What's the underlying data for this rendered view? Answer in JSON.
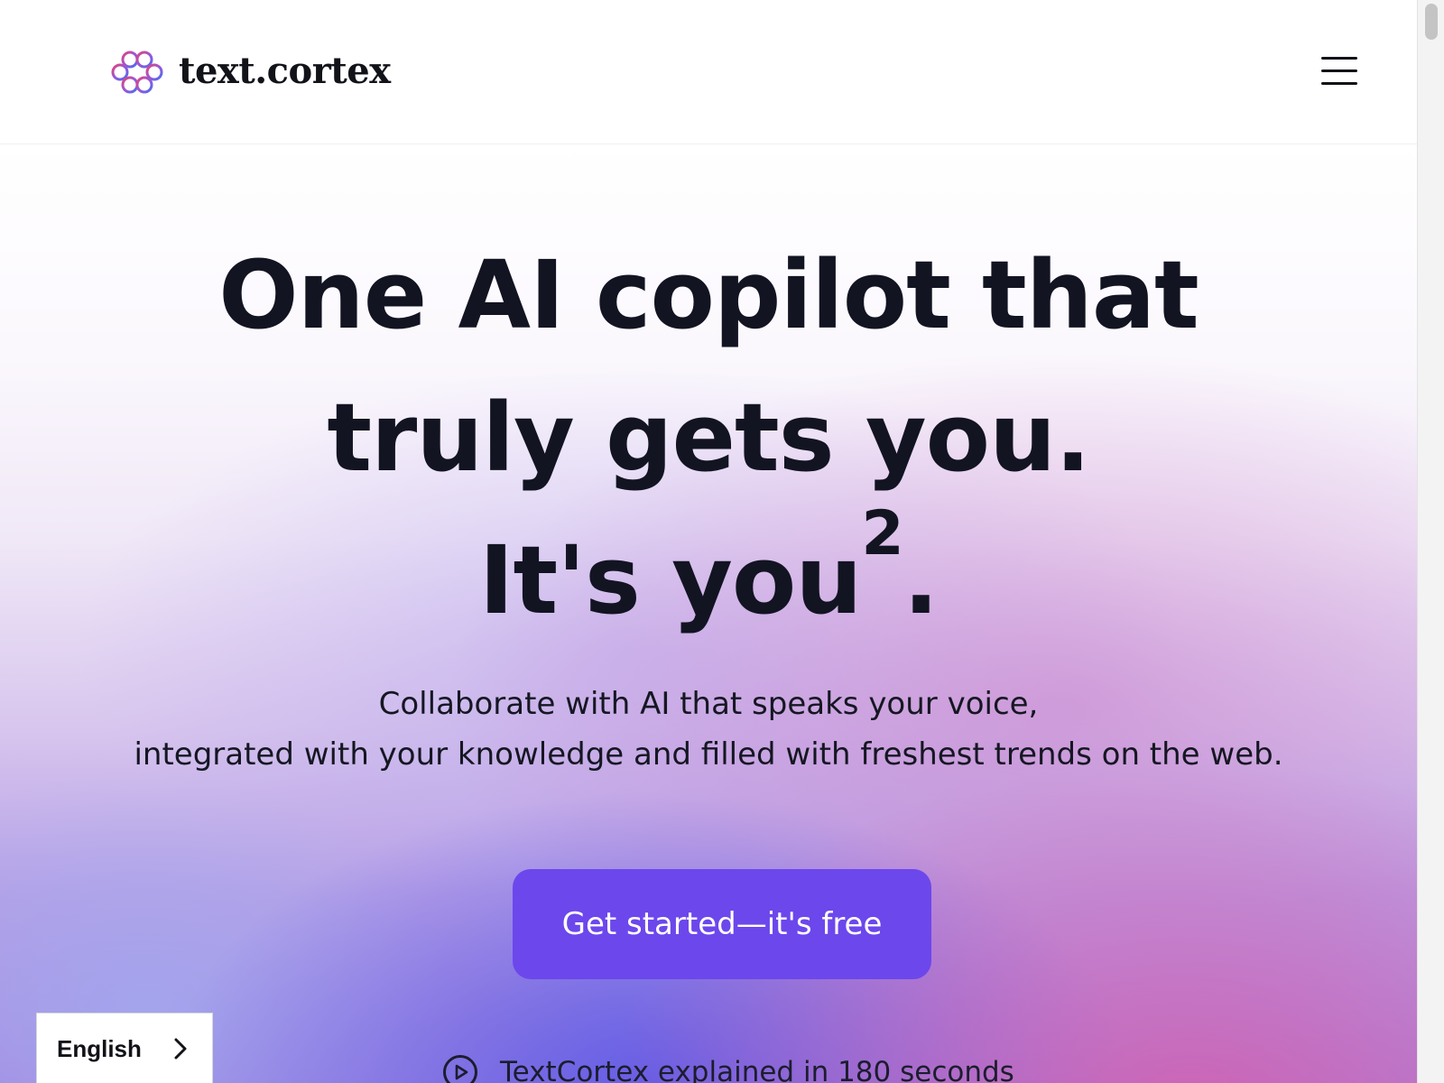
{
  "brand": {
    "name": "text.cortex",
    "logo_icon": "brain-flower-logo-icon",
    "logo_colors": [
      "#e0457b",
      "#9b57d6",
      "#4a6cf0"
    ]
  },
  "header": {
    "menu_icon": "hamburger-menu-icon"
  },
  "hero": {
    "headline": {
      "line1": "One AI copilot that",
      "line2": "truly gets you.",
      "line3_main": "It's you",
      "line3_sup": "2",
      "line3_end": "."
    },
    "subtext": {
      "line1": "Collaborate with AI that speaks your voice,",
      "line2": "integrated with your knowledge and filled with freshest trends on the web."
    },
    "cta_label": "Get started—it's free",
    "video_link_label": "TextCortex explained in 180 seconds",
    "video_icon": "play-circle-icon"
  },
  "language_selector": {
    "selected": "English",
    "icon": "chevron-right-icon"
  },
  "colors": {
    "accent": "#6c47ec",
    "text": "#121422",
    "gradient_purple": "#5f5ae6",
    "gradient_pink": "#d85aaa"
  }
}
